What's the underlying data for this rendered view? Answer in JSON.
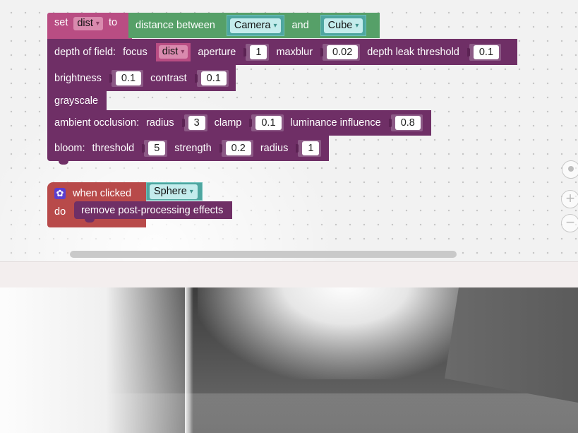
{
  "blocks": {
    "set": {
      "label": "set",
      "var": "dist",
      "to": "to"
    },
    "distance": {
      "label": "distance between",
      "a": "Camera",
      "and": "and",
      "b": "Cube"
    },
    "dof": {
      "label": "depth of field:",
      "focus": "focus",
      "focus_var": "dist",
      "aperture": "aperture",
      "aperture_val": "1",
      "maxblur": "maxblur",
      "maxblur_val": "0.02",
      "leak": "depth leak threshold",
      "leak_val": "0.1"
    },
    "bc": {
      "brightness": "brightness",
      "brightness_val": "0.1",
      "contrast": "contrast",
      "contrast_val": "0.1"
    },
    "grayscale": {
      "label": "grayscale"
    },
    "ao": {
      "label": "ambient occlusion:",
      "radius": "radius",
      "radius_val": "3",
      "clamp": "clamp",
      "clamp_val": "0.1",
      "lum": "luminance influence",
      "lum_val": "0.8"
    },
    "bloom": {
      "label": "bloom:",
      "threshold": "threshold",
      "threshold_val": "5",
      "strength": "strength",
      "strength_val": "0.2",
      "radius": "radius",
      "radius_val": "1"
    },
    "event": {
      "when": "when clicked",
      "target": "Sphere",
      "do": "do",
      "action": "remove post-processing effects"
    }
  },
  "icons": {
    "gear": "gear-icon",
    "center": "target-icon",
    "zoom_in": "plus-icon",
    "zoom_out": "minus-icon",
    "dropdown": "▾"
  },
  "colors": {
    "purple": "#6f2f66",
    "pink": "#b94d83",
    "green": "#56a068",
    "teal": "#4ea6a0",
    "red": "#b84a4a"
  }
}
